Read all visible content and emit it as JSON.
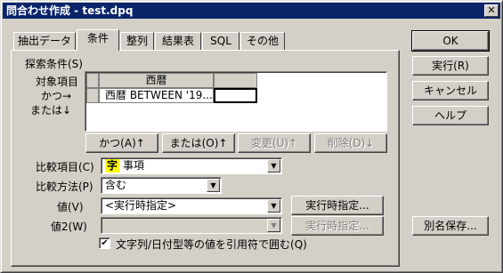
{
  "window": {
    "title": "問合わせ作成 - test.dpq",
    "close_glyph": "✕"
  },
  "tabs": [
    {
      "label": "抽出データ"
    },
    {
      "label": "条件"
    },
    {
      "label": "整列"
    },
    {
      "label": "結果表"
    },
    {
      "label": "SQL"
    },
    {
      "label": "その他"
    }
  ],
  "criteria": {
    "group_label": "探索条件(S)",
    "row_label_target": "対象項目",
    "row_label_and": "かつ→",
    "row_label_or": "または↓",
    "grid_header": "西暦",
    "grid_condition": "西暦 BETWEEN '19..."
  },
  "grid_buttons": {
    "and": "かつ(A)↑",
    "or": "または(O)↑",
    "modify": "変更(U)↑",
    "delete": "削除(D)↓"
  },
  "form": {
    "compare_item_label": "比較項目(C)",
    "compare_item_icon_text": "字",
    "compare_item_value": "事項",
    "compare_method_label": "比較方法(P)",
    "compare_method_value": "含む",
    "value_label": "値(V)",
    "value_value": "<実行時指定>",
    "value_runtime_button": "実行時指定...",
    "value2_label": "値2(W)",
    "value2_value": "",
    "value2_runtime_button": "実行時指定...",
    "quote_checkbox_label": "文字列/日付型等の値を引用符で囲む(Q)",
    "quote_checked": true,
    "check_glyph": "✔",
    "arrow_glyph": "▼"
  },
  "side_buttons": {
    "ok": "OK",
    "execute": "実行(R)",
    "cancel": "キャンセル",
    "help": "ヘルプ",
    "save_as": "別名保存..."
  }
}
